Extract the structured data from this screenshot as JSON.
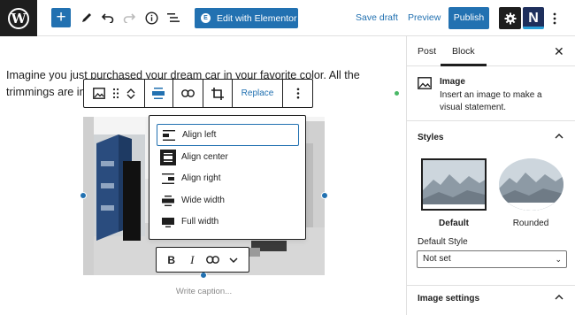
{
  "header": {
    "edit_with_elementor": "Edit with Elementor",
    "elementor_icon_letter": "E",
    "save_draft": "Save draft",
    "preview": "Preview",
    "publish": "Publish",
    "plugin_letter": "N",
    "logo_letter": "W"
  },
  "editor": {
    "paragraph": "Imagine you just purchased your dream car in your favorite color. All the trimmings are included, and it e",
    "replace": "Replace",
    "caption_placeholder": "Write caption...",
    "align_options": [
      "Align left",
      "Align center",
      "Align right",
      "Wide width",
      "Full width"
    ],
    "format": {
      "bold": "B",
      "italic": "I"
    }
  },
  "sidebar": {
    "tabs": [
      "Post",
      "Block"
    ],
    "active_tab": "Block",
    "block_title": "Image",
    "block_description": "Insert an image to make a visual statement.",
    "styles_heading": "Styles",
    "style_options": [
      "Default",
      "Rounded"
    ],
    "default_style_label": "Default Style",
    "default_style_value": "Not set",
    "image_settings_heading": "Image settings"
  },
  "colors": {
    "accent": "#2271b1",
    "dark": "#1e1e1e",
    "border": "#e0e0e0",
    "indicator": "#4ab866"
  },
  "icons": [
    "wordpress-logo-icon",
    "plus-icon",
    "pencil-icon",
    "undo-icon",
    "redo-icon",
    "info-icon",
    "list-view-icon",
    "gear-icon",
    "vertical-dots-icon",
    "image-icon",
    "drag-handle-icon",
    "chevron-up-icon",
    "chevron-down-icon",
    "align-icon",
    "link-icon",
    "crop-icon",
    "close-icon"
  ]
}
